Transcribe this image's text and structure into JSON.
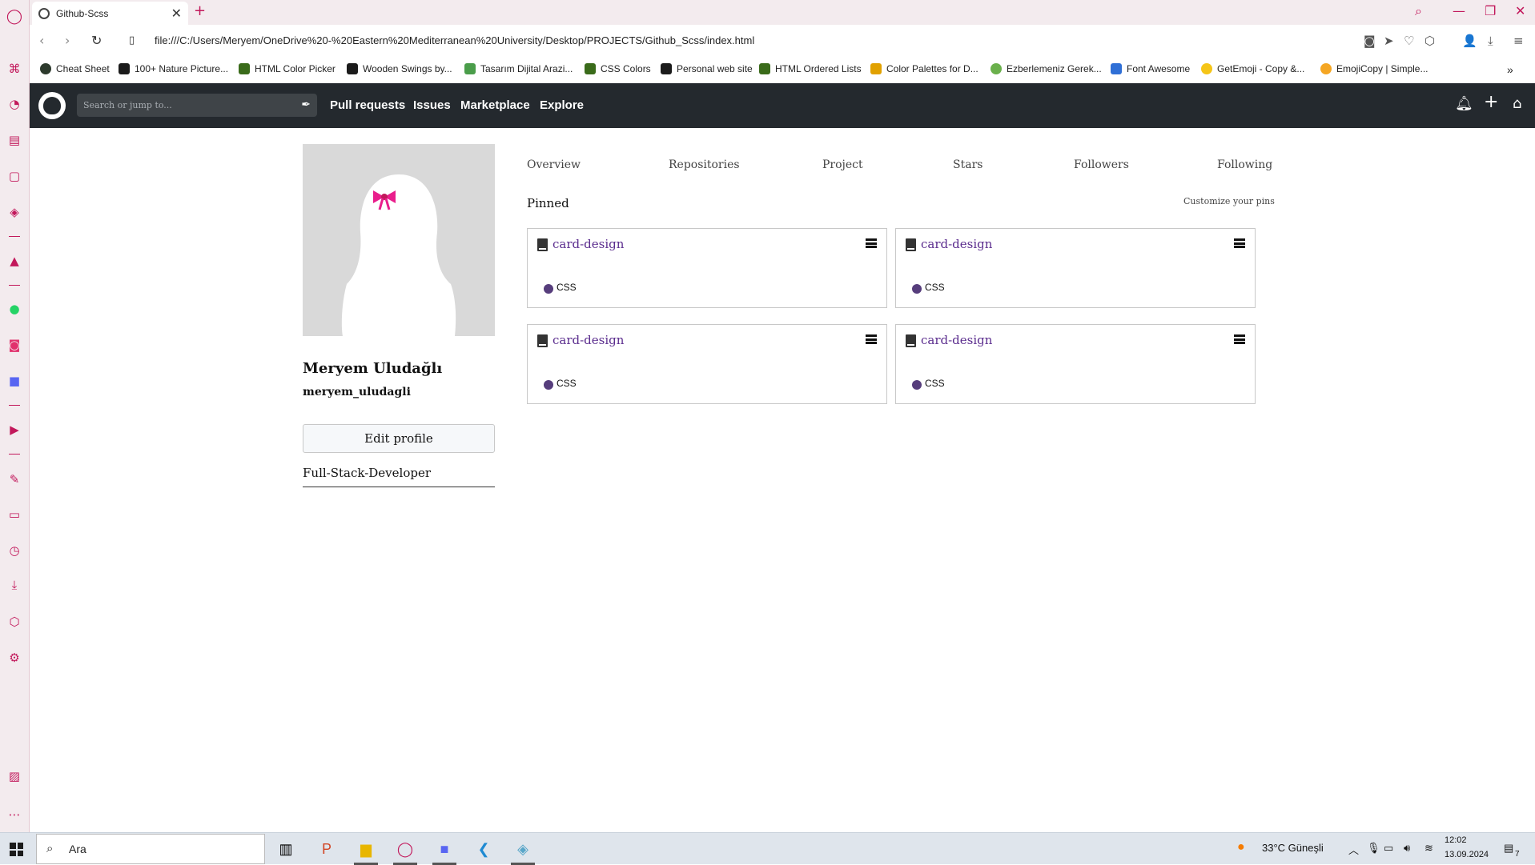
{
  "browser": {
    "tab_title": "Github-Scss",
    "url": "file:///C:/Users/Meryem/OneDrive%20-%20Eastern%20Mediterranean%20University/Desktop/PROJECTS/Github_Scss/index.html",
    "bookmarks": [
      {
        "label": "Cheat Sheet",
        "color": "#2d3a2d"
      },
      {
        "label": "100+ Nature Picture...",
        "color": "#1b1b1b"
      },
      {
        "label": "HTML Color Picker",
        "color": "#3a6b1a"
      },
      {
        "label": "Wooden Swings by...",
        "color": "#1b1b1b"
      },
      {
        "label": "Tasarım Dijital Arazi...",
        "color": "#4a9d4a"
      },
      {
        "label": "CSS Colors",
        "color": "#3a6b1a"
      },
      {
        "label": "Personal web site",
        "color": "#1b1b1b"
      },
      {
        "label": "HTML Ordered Lists",
        "color": "#3a6b1a"
      },
      {
        "label": "Color Palettes for D...",
        "color": "#e1a100"
      },
      {
        "label": "Ezberlemeniz Gerek...",
        "color": "#6ab04c"
      },
      {
        "label": "Font Awesome",
        "color": "#2f6fd6"
      },
      {
        "label": "GetEmoji - Copy &...",
        "color": "#f5c518"
      },
      {
        "label": "EmojiCopy | Simple...",
        "color": "#f5a623"
      }
    ]
  },
  "github": {
    "search_placeholder": "Search or jump to...",
    "nav": [
      "Pull requests",
      "Issues",
      "Marketplace",
      "Explore"
    ]
  },
  "profile": {
    "name": "Meryem Uludağlı",
    "username": "meryem_uludagli",
    "edit_label": "Edit profile",
    "bio": "Full-Stack-Developer"
  },
  "tabs": [
    "Overview",
    "Repositories",
    "Project",
    "Stars",
    "Followers",
    "Following"
  ],
  "pinned": {
    "heading": "Pinned",
    "customize": "Customize your pins",
    "cards": [
      {
        "title": "card-design",
        "lang": "CSS"
      },
      {
        "title": "card-design",
        "lang": "CSS"
      },
      {
        "title": "card-design",
        "lang": "CSS"
      },
      {
        "title": "card-design",
        "lang": "CSS"
      }
    ]
  },
  "taskbar": {
    "search_text": "Ara",
    "weather": "33°C  Güneşli",
    "time": "12:02",
    "date": "13.09.2024",
    "notifications": "7"
  },
  "colors": {
    "accent": "#c2185b",
    "github_header": "#24292e",
    "link": "#5b2d8e",
    "css_dot": "#563d7c"
  }
}
